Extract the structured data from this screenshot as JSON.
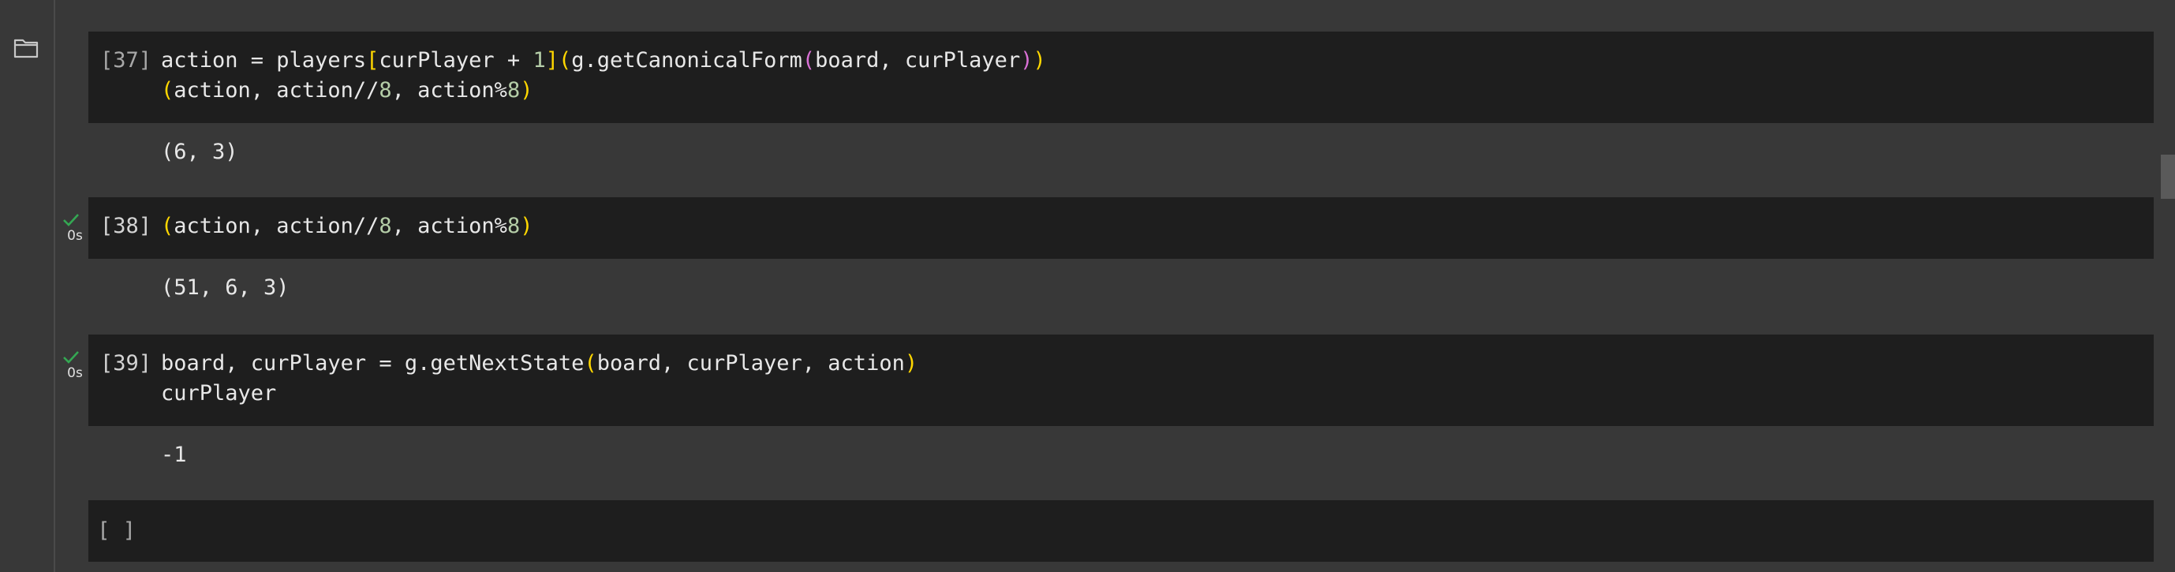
{
  "sidebar": {
    "icon": "folder-icon"
  },
  "cells": [
    {
      "prompt": "[37]",
      "status": null,
      "code": [
        [
          {
            "t": "action = players",
            "c": ""
          },
          {
            "t": "[",
            "c": "b1"
          },
          {
            "t": "curPlayer + ",
            "c": ""
          },
          {
            "t": "1",
            "c": "num"
          },
          {
            "t": "]",
            "c": "b1"
          },
          {
            "t": "(",
            "c": "b1"
          },
          {
            "t": "g.getCanonicalForm",
            "c": ""
          },
          {
            "t": "(",
            "c": "b2"
          },
          {
            "t": "board, curPlayer",
            "c": ""
          },
          {
            "t": ")",
            "c": "b2"
          },
          {
            "t": ")",
            "c": "b1"
          }
        ],
        [
          {
            "t": "(",
            "c": "b1"
          },
          {
            "t": "action, action//",
            "c": ""
          },
          {
            "t": "8",
            "c": "num"
          },
          {
            "t": ", action%",
            "c": ""
          },
          {
            "t": "8",
            "c": "num"
          },
          {
            "t": ")",
            "c": "b1"
          }
        ]
      ],
      "output": "(6, 3)"
    },
    {
      "prompt": "[38]",
      "status": {
        "icon": "check-icon",
        "time": "0s"
      },
      "code": [
        [
          {
            "t": "(",
            "c": "b1"
          },
          {
            "t": "action, action//",
            "c": ""
          },
          {
            "t": "8",
            "c": "num"
          },
          {
            "t": ", action%",
            "c": ""
          },
          {
            "t": "8",
            "c": "num"
          },
          {
            "t": ")",
            "c": "b1"
          }
        ]
      ],
      "output": "(51, 6, 3)"
    },
    {
      "prompt": "[39]",
      "status": {
        "icon": "check-icon",
        "time": "0s"
      },
      "code": [
        [
          {
            "t": "board, curPlayer = g.getNextState",
            "c": ""
          },
          {
            "t": "(",
            "c": "b1"
          },
          {
            "t": "board, curPlayer, action",
            "c": ""
          },
          {
            "t": ")",
            "c": "b1"
          }
        ],
        [
          {
            "t": "curPlayer",
            "c": ""
          }
        ]
      ],
      "output": "-1"
    },
    {
      "prompt": "[ ]",
      "status": null,
      "code": [],
      "output": null
    }
  ],
  "colors": {
    "background": "#383838",
    "cell_background": "#1e1e1e",
    "check": "#34a853",
    "number": "#b5cea8",
    "bracket_level1": "#ffd700",
    "bracket_level2": "#da70d6"
  }
}
